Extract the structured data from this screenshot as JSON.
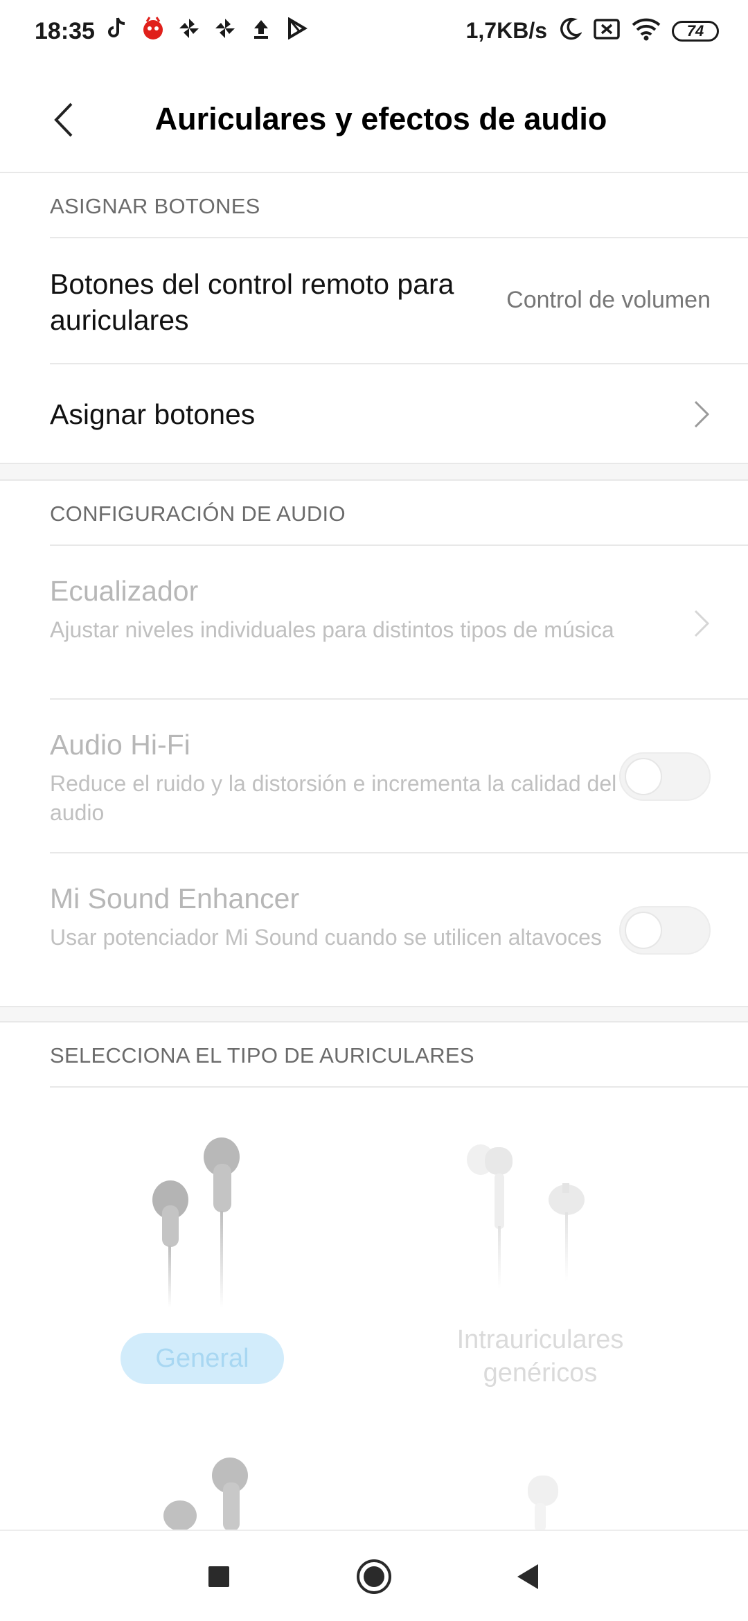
{
  "status_bar": {
    "time": "18:35",
    "left_icons": [
      "tiktok-icon",
      "antutu-icon",
      "pinwheel-icon",
      "pinwheel-icon",
      "upload-icon",
      "play-store-icon"
    ],
    "net_speed": "1,7KB/s",
    "right_icons": [
      "moon-icon",
      "no-sim-icon",
      "wifi-icon"
    ],
    "battery": "74"
  },
  "header": {
    "title": "Auriculares y efectos de audio"
  },
  "section_buttons": {
    "header": "ASIGNAR BOTONES",
    "remote_title": "Botones del control remoto para auriculares",
    "remote_value": "Control de volumen",
    "assign_title": "Asignar botones"
  },
  "section_audio": {
    "header": "CONFIGURACIÓN DE AUDIO",
    "equalizer_title": "Ecualizador",
    "equalizer_sub": "Ajustar niveles individuales para distintos tipos de música",
    "hifi_title": "Audio Hi-Fi",
    "hifi_sub": "Reduce el ruido y la distorsión e incrementa la calidad del audio",
    "hifi_on": false,
    "enhancer_title": "Mi Sound Enhancer",
    "enhancer_sub": "Usar potenciador Mi Sound cuando se utilicen altavoces",
    "enhancer_on": false
  },
  "section_types": {
    "header": "SELECCIONA EL TIPO DE AURICULARES",
    "general_label": "General",
    "generic_label": "Intrauriculares genéricos"
  },
  "nav": {
    "icons": [
      "recents-square-icon",
      "home-circle-icon",
      "back-triangle-icon"
    ]
  },
  "colors": {
    "accent_light": "#d2ecfb",
    "disabled_text": "#b7b7b7"
  }
}
